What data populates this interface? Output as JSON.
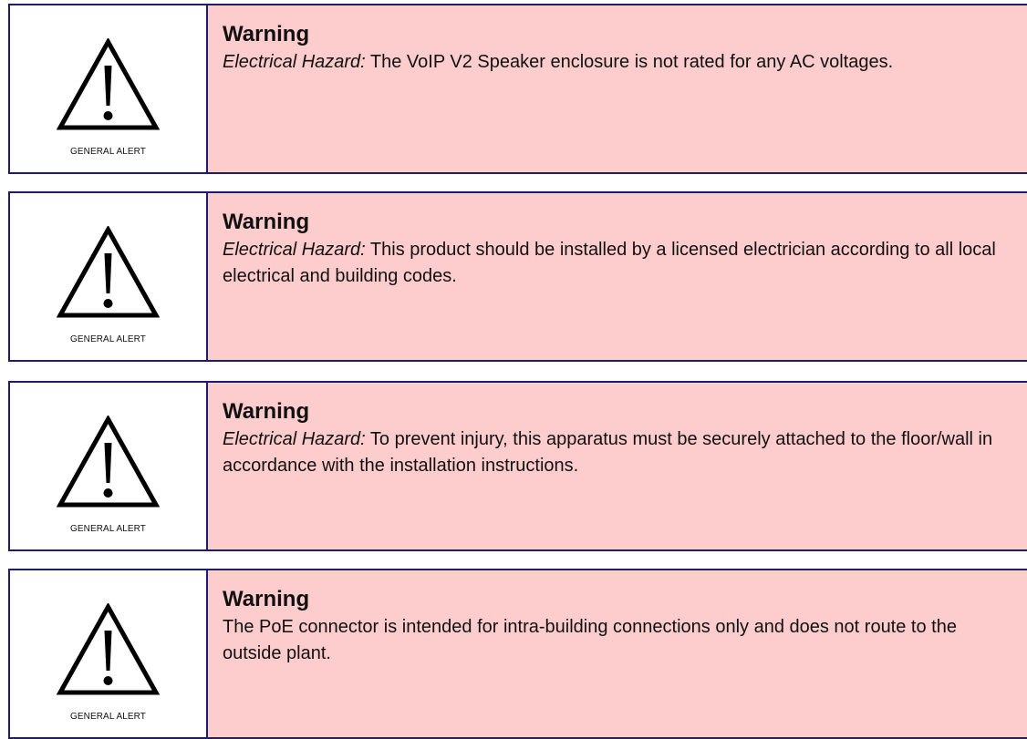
{
  "warnings": [
    {
      "icon": "warning-triangle-icon",
      "icon_caption": "GENERAL ALERT",
      "title": "Warning",
      "hazard_label": "Electrical Hazard:",
      "message": " The VoIP V2 Speaker enclosure is not rated for any AC voltages."
    },
    {
      "icon": "warning-triangle-icon",
      "icon_caption": "GENERAL ALERT",
      "title": "Warning",
      "hazard_label": "Electrical Hazard:",
      "message": " This product should be installed by a licensed electrician according to all local electrical and building codes."
    },
    {
      "icon": "warning-triangle-icon",
      "icon_caption": "GENERAL ALERT",
      "title": "Warning",
      "hazard_label": "Electrical Hazard:",
      "message": " To prevent injury, this apparatus must be securely attached to the floor/wall in accordance with the installation instructions."
    },
    {
      "icon": "warning-triangle-icon",
      "icon_caption": "GENERAL ALERT",
      "title": "Warning",
      "hazard_label": "",
      "message": "The PoE connector is intended for intra-building connections only and does not route to the outside plant."
    }
  ],
  "colors": {
    "border": "#1f1c6e",
    "message_background": "#fdcccc",
    "icon_background": "#ffffff",
    "text": "#111111"
  }
}
